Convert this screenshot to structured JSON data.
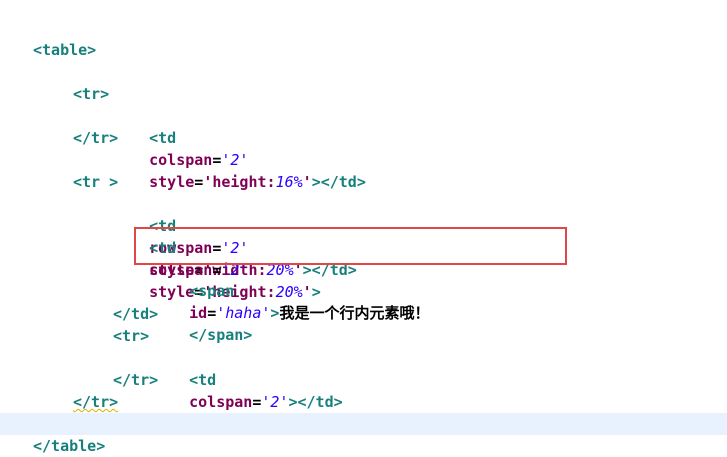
{
  "lines": [
    {
      "tag_open": "<table>"
    },
    {
      "tag_open": "<tr>"
    },
    {
      "td_open": "<td",
      "attr": "colspan",
      "eq": "=",
      "val": "'2'",
      "attr2": "style",
      "eq2": "=",
      "v2a": "'height:",
      "v2b": "16%",
      "v2c": "'",
      "close": "></td>"
    },
    {
      "tag_close": "</tr>"
    },
    {
      "tag_open": "<tr >"
    },
    {
      "td_open": "<td",
      "attr": "rowspan",
      "eq": "=",
      "val": "'2'",
      "attr2": "style",
      "eq2": "=",
      "v2a": "'width:",
      "v2b": "20%",
      "v2c": "'",
      "close": "></td>"
    },
    {
      "td_open": "<td",
      "attr": "colspan",
      "eq": "=",
      "val": "'2'",
      "attr2": "style",
      "eq2": "=",
      "v2a": "'height:",
      "v2b": "20%",
      "v2c": "'",
      "close": ">"
    },
    {
      "span_open": "<span",
      "attr": "id",
      "eq": "=",
      "val": "'haha'",
      "gt": ">",
      "text": "我是一个行内元素哦！",
      "close": "</span>"
    },
    {
      "tag_close": "</td>"
    },
    {
      "tag_open": "<tr>"
    },
    {
      "td_open": "<td",
      "attr": "colspan",
      "eq": "=",
      "val": "'2'",
      "close": "></td>"
    },
    {
      "tag_close": "</tr>"
    },
    {
      "tag_close": "</tr>"
    },
    {
      "tag_close": "</table>"
    }
  ],
  "highlight": {
    "color": "#e04848"
  }
}
